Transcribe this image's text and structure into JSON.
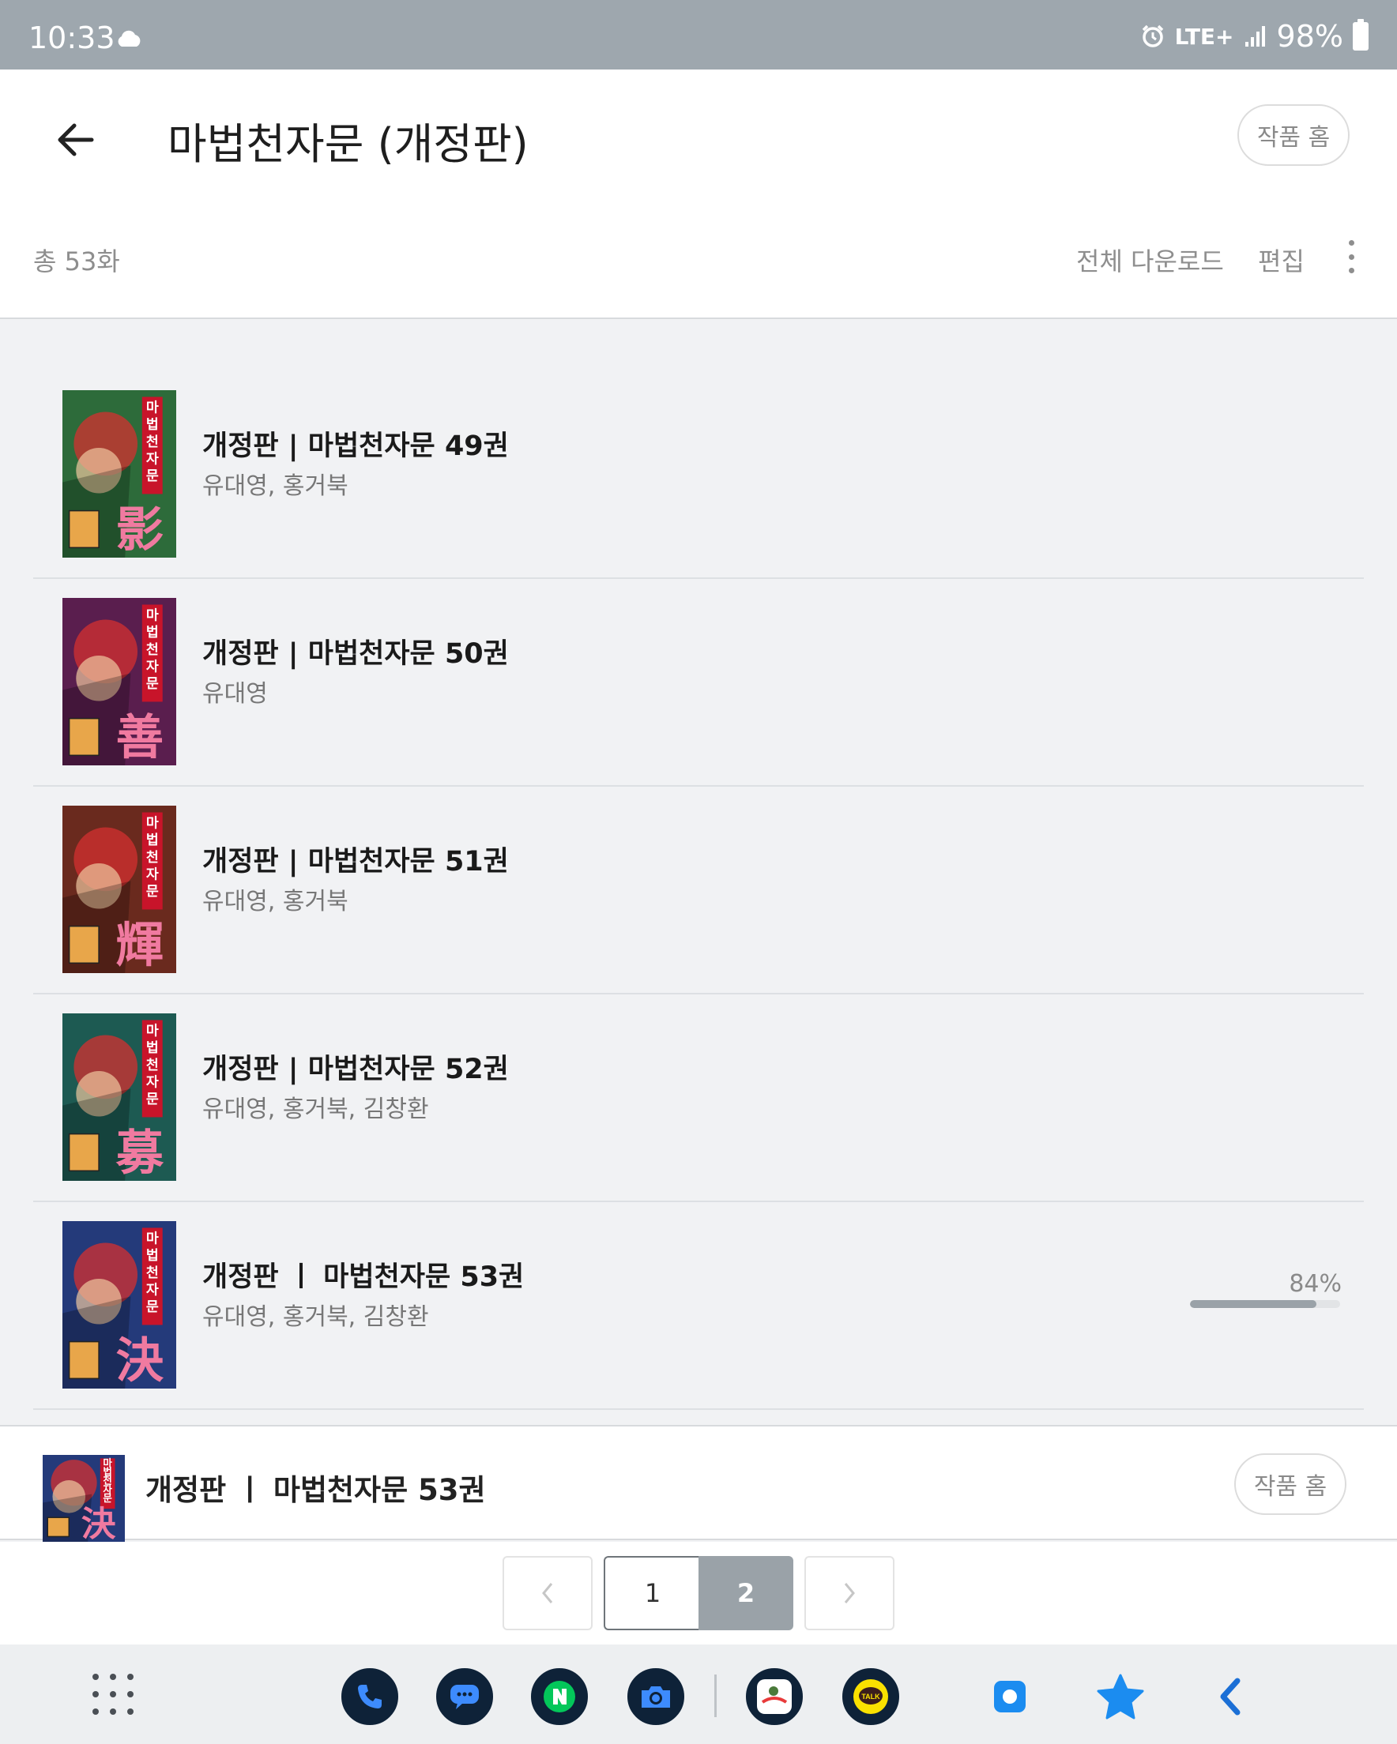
{
  "status_bar": {
    "time": "10:33",
    "network": "LTE+",
    "battery": "98%"
  },
  "header": {
    "title": "마법천자문 (개정판)",
    "work_home_label": "작품 홈",
    "total_count": "총 53화",
    "download_all_label": "전체 다운로드",
    "edit_label": "편집"
  },
  "items": [
    {
      "title": "개정판 | 마법천자문 49권",
      "authors": "유대영, 홍거북",
      "cover_char": "影",
      "cover_color": "#2d6b3a"
    },
    {
      "title": "개정판 | 마법천자문 50권",
      "authors": "유대영",
      "cover_char": "善",
      "cover_color": "#5a1e4e"
    },
    {
      "title": "개정판 | 마법천자문 51권",
      "authors": "유대영, 홍거북",
      "cover_char": "輝",
      "cover_color": "#6a2a1e"
    },
    {
      "title": "개정판 | 마법천자문 52권",
      "authors": "유대영, 홍거북, 김창환",
      "cover_char": "募",
      "cover_color": "#1d5a52"
    },
    {
      "title": "개정판 ㅣ 마법천자문 53권",
      "authors": "유대영, 홍거북, 김창환",
      "cover_char": "決",
      "cover_color": "#243a7a",
      "progress_text": "84%",
      "progress": 0.84
    }
  ],
  "cover_spine_text": "마법천자문",
  "now_reading": {
    "title": "개정판 ㅣ 마법천자문 53권",
    "work_home_label": "작품 홈"
  },
  "pagination": {
    "prev": "<",
    "page1": "1",
    "page2": "2",
    "next": ">",
    "current": 2
  },
  "taskbar": {
    "apps": [
      {
        "name": "phone",
        "color": "#1b6fd6"
      },
      {
        "name": "messages",
        "color": "#1b6fd6"
      },
      {
        "name": "naver",
        "color": "#03c75a"
      },
      {
        "name": "camera",
        "color": "#1b6fd6"
      },
      {
        "name": "webtoon-app",
        "color": "#e83a3a"
      },
      {
        "name": "kakaotalk",
        "color": "#fae100"
      }
    ],
    "accent": "#1b6fd6"
  }
}
